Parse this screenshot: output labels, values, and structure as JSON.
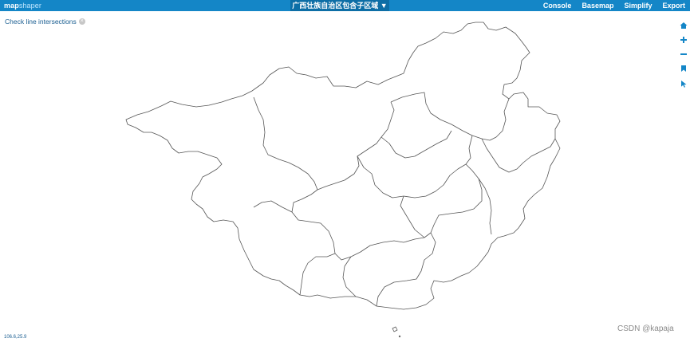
{
  "app": {
    "logo_primary": "map",
    "logo_secondary": "shaper"
  },
  "layer_select": {
    "label": "广西壮族自治区包含子区域 ▼"
  },
  "menu": {
    "items": [
      "Console",
      "Basemap",
      "Simplify",
      "Export"
    ]
  },
  "intersections": {
    "label": "Check line intersections",
    "close_glyph": "×"
  },
  "status": {
    "coordinates": "106.6,25.9"
  },
  "watermark": {
    "text": "CSDN @kapaja"
  },
  "tools": [
    "home-icon",
    "zoom-in-icon",
    "zoom-out-icon",
    "bookmark-icon",
    "pointer-icon"
  ],
  "colors": {
    "accent": "#1486c7",
    "accent_dark": "#0d6ea6",
    "link": "#1a5e91",
    "map_stroke": "#555555"
  }
}
